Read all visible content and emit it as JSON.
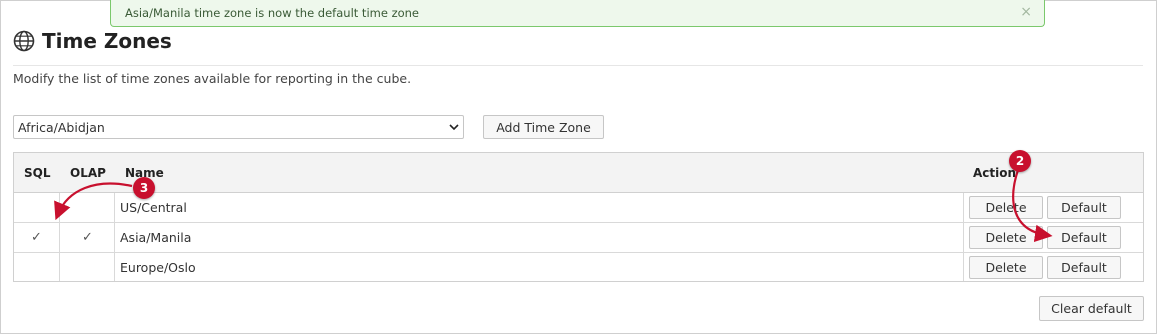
{
  "notification": {
    "message": "Asia/Manila time zone is now the default time zone",
    "close": "×"
  },
  "page": {
    "title": "Time Zones",
    "icon": "globe-icon",
    "description": "Modify the list of time zones available for reporting in the cube."
  },
  "add_form": {
    "selected_zone": "Africa/Abidjan",
    "add_label": "Add Time Zone"
  },
  "table": {
    "headers": {
      "sql": "SQL",
      "olap": "OLAP",
      "name": "Name",
      "action": "Action"
    },
    "rows": [
      {
        "name": "US/Central",
        "sql": "",
        "olap": "",
        "delete": "Delete",
        "default": "Default"
      },
      {
        "name": "Asia/Manila",
        "sql": "✓",
        "olap": "✓",
        "delete": "Delete",
        "default": "Default"
      },
      {
        "name": "Europe/Oslo",
        "sql": "",
        "olap": "",
        "delete": "Delete",
        "default": "Default"
      }
    ]
  },
  "clear_default_label": "Clear default",
  "annotations": {
    "badge_2": "2",
    "badge_3": "3",
    "color": "#c8102e"
  }
}
